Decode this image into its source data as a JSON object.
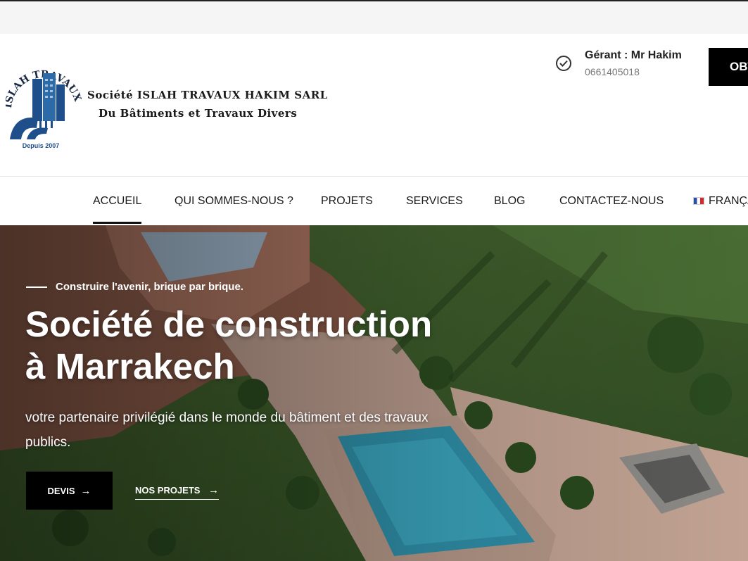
{
  "header": {
    "logo": {
      "arc_text": "ISLAH TRAVAUX HAKIM",
      "since": "Depuis 2007"
    },
    "company_line1": "Société ISLAH TRAVAUX HAKIM SARL",
    "company_line2": "Du Bâtiments  et Travaux Divers",
    "manager_label": "Gérant : Mr Hakim",
    "manager_phone": "0661405018",
    "cta_label": "OBT"
  },
  "nav": {
    "items": [
      {
        "label": "ACCUEIL",
        "active": true
      },
      {
        "label": "QUI SOMMES-NOUS ?"
      },
      {
        "label": "PROJETS"
      },
      {
        "label": "SERVICES"
      },
      {
        "label": "BLOG"
      },
      {
        "label": "CONTACTEZ-NOUS"
      },
      {
        "label": "FRANÇA"
      }
    ]
  },
  "hero": {
    "tagline": "Construire l'avenir, brique par brique.",
    "title_line1": "Société de construction",
    "title_line2": "à Marrakech",
    "description": " votre partenaire privilégié dans le monde du bâtiment et des travaux publics.",
    "btn_devis": "DEVIS",
    "btn_projets": "NOS PROJETS",
    "arrow": "→"
  },
  "colors": {
    "accent": "#000000",
    "text_dark": "#1a1a1a",
    "logo_blue": "#1e4f8a"
  }
}
